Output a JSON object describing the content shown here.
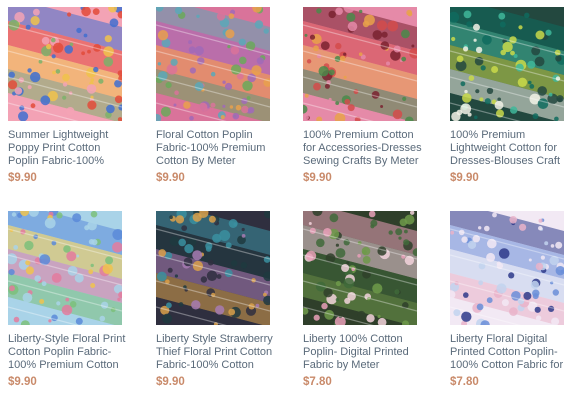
{
  "products": [
    {
      "title": "Summer Lightweight Poppy Print Cotton Poplin Fabric-100%",
      "price": "$9.90",
      "image": "fabric-poppy-print",
      "colors": [
        "#3f6fd0",
        "#e24b3a",
        "#f0c24b",
        "#7bb26a",
        "#f3a3b5"
      ]
    },
    {
      "title": "Floral Cotton Poplin Fabric-100% Premium Cotton By Meter",
      "price": "$9.90",
      "image": "fabric-floral-stack",
      "colors": [
        "#5aa8b8",
        "#a06ab8",
        "#e9a04c",
        "#6aa95a",
        "#d9739a"
      ]
    },
    {
      "title": "100% Premium Cotton for Accessories-Dresses Sewing Crafts By Meter",
      "price": "$9.90",
      "image": "fabric-ditsy-print",
      "colors": [
        "#7a2230",
        "#d44b4b",
        "#e9a24a",
        "#4a8a4a",
        "#e58aa8"
      ]
    },
    {
      "title": "100% Premium Lightweight Cotton for Dresses-Blouses Craft",
      "price": "$9.90",
      "image": "fabric-green-leaf-print",
      "colors": [
        "#0f6b5e",
        "#3fb79a",
        "#c9d94a",
        "#f2f2e6",
        "#23483f"
      ]
    },
    {
      "title": "Liberty-Style Floral Print Cotton Poplin Fabric-100% Premium Cotton",
      "price": "$9.90",
      "image": "fabric-liberty-style",
      "colors": [
        "#5b8ad8",
        "#f0c34d",
        "#e37b9e",
        "#7cc07a",
        "#a9d3e8"
      ]
    },
    {
      "title": "Liberty Style Strawberry Thief Floral Print Cotton Fabric-100% Cotton",
      "price": "$9.90",
      "image": "fabric-strawberry-thief",
      "colors": [
        "#3a8fa0",
        "#1e3a40",
        "#a77bb3",
        "#d9a04a",
        "#2f2f3f"
      ]
    },
    {
      "title": "Liberty 100% Cotton Poplin- Digital Printed Fabric by Meter",
      "price": "$7.80",
      "image": "fabric-tulip-print",
      "colors": [
        "#e9a0b8",
        "#f3d3dc",
        "#3f6a3a",
        "#6f9a4a",
        "#2f3f2a"
      ]
    },
    {
      "title": "Liberty Floral Digital Printed Cotton Poplin-100% Cotton Fabric for",
      "price": "$7.80",
      "image": "fabric-blue-digital-floral",
      "colors": [
        "#2e3a8a",
        "#6a8ed8",
        "#c2d4ef",
        "#e9b3c9",
        "#f2e9f4"
      ]
    }
  ]
}
